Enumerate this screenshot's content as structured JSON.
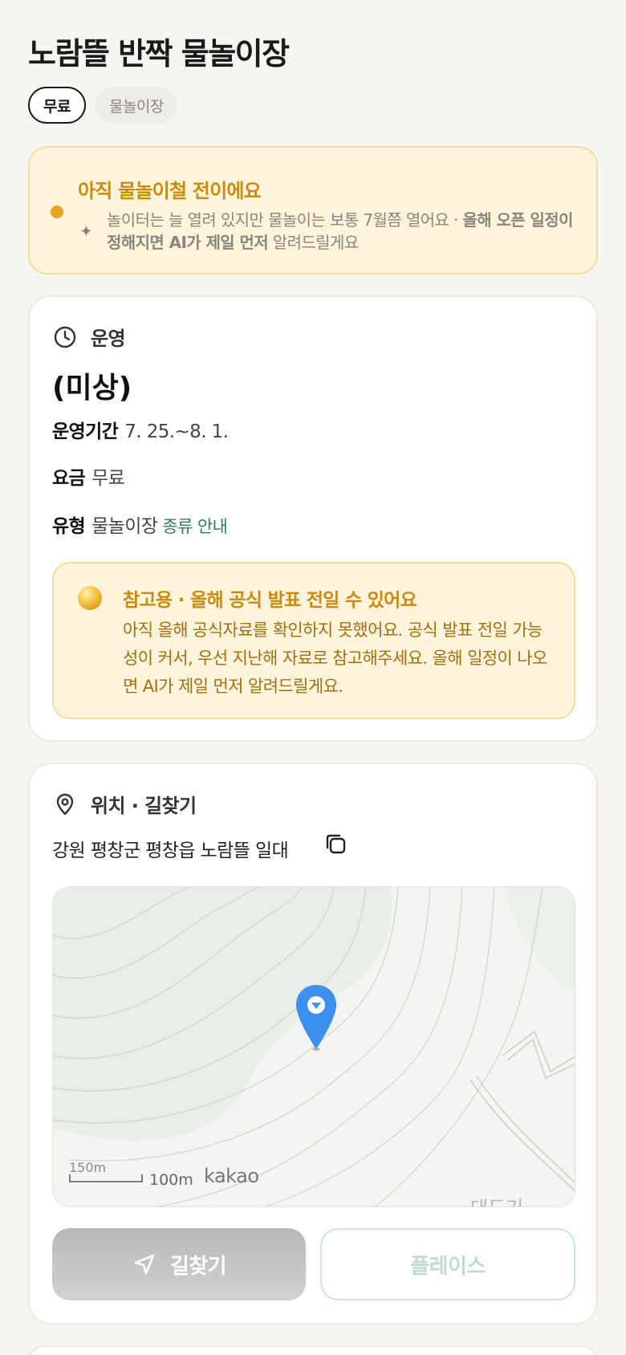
{
  "page": {
    "title": "노람뜰 반짝 물놀이장",
    "chips": [
      "무료",
      "물놀이장"
    ]
  },
  "notice": {
    "title": "아직 물놀이철 전이에요",
    "text_plain": "놀이터는 늘 열려 있지만 물놀이는 보통 7월쯤 열어요 · ",
    "text_bold1": "올해 오픈 일정이 정해지면 AI가 제일 먼저",
    "text_end": " 알려드릴게요"
  },
  "operation": {
    "header": "운영",
    "status": "(미상)",
    "period_label": "운영기간",
    "period_value": "7. 25.~8. 1.",
    "fee_label": "요금",
    "fee_value": "무료",
    "type_label": "유형",
    "type_value": "물놀이장",
    "type_link": "종류 안내",
    "reference": {
      "title": "참고용 · 올해 공식 발표 전일 수 있어요",
      "text": "아직 올해 공식자료를 확인하지 못했어요. 공식 발표 전일 가능성이 커서, 우선 지난해 자료로 참고해주세요. 올해 일정이 나오면 AI가 제일 먼저 알려드릴게요."
    }
  },
  "location": {
    "header": "위치 · 길찾기",
    "address": "강원 평창군 평창읍 노람뜰 일대",
    "map": {
      "scale_small": "150m",
      "scale_label": "100m",
      "brand": "kakao",
      "place_partial": "대도기"
    },
    "buttons": {
      "directions": "길찾기",
      "place": "플레이스"
    }
  },
  "colors": {
    "accent_gold": "#c98a0e",
    "notice_bg": "#fef4dc",
    "pin_blue": "#3d8ff0",
    "link_green": "#2f7d5a"
  }
}
